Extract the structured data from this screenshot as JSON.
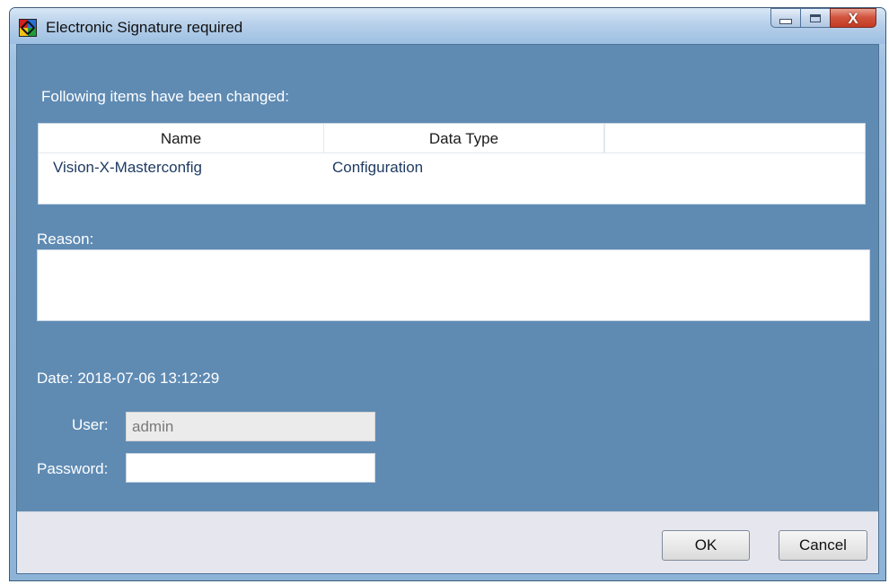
{
  "window": {
    "title": "Electronic Signature required",
    "icon": "app-logo-icon",
    "caption_buttons": [
      "minimize-icon",
      "maximize-icon",
      "close-icon"
    ],
    "close_glyph": "X"
  },
  "changes": {
    "label": "Following items have been changed:",
    "columns": [
      "Name",
      "Data Type",
      ""
    ],
    "rows": [
      {
        "name": "Vision-X-Masterconfig",
        "data_type": "Configuration"
      }
    ]
  },
  "reason": {
    "label": "Reason:",
    "value": ""
  },
  "date": {
    "text": "Date: 2018-07-06 13:12:29"
  },
  "user": {
    "label": "User:",
    "value": "admin"
  },
  "password": {
    "label": "Password:",
    "value": ""
  },
  "buttons": {
    "ok": "OK",
    "cancel": "Cancel"
  },
  "colors": {
    "client_background": "#5f8bb3",
    "footer_background": "#e6e7ee",
    "label_text": "#ffffff",
    "cell_text": "#1f3b63"
  }
}
